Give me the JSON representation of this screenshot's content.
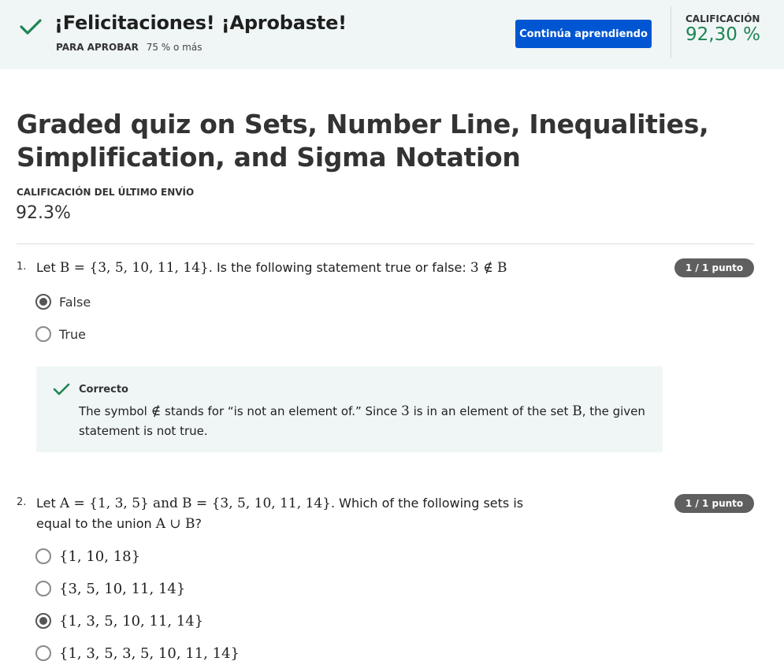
{
  "banner": {
    "title": "¡Felicitaciones! ¡Aprobaste!",
    "pass_label": "PARA APROBAR",
    "pass_value": "75 % o más",
    "continue_button": "Continúa aprendiendo",
    "grade_label": "CALIFICACIÓN",
    "grade_value": "92,30 %",
    "accent_color": "#1e8453",
    "button_color": "#0056d2"
  },
  "quiz": {
    "title": "Graded quiz on Sets, Number Line, Inequalities, Simplification, and Sigma Notation",
    "last_submission_label": "CALIFICACIÓN DEL ÚLTIMO ENVÍO",
    "last_submission_value": "92.3%"
  },
  "questions": [
    {
      "number": "1.",
      "text_parts": [
        "Let",
        "B = {3, 5, 10, 11, 14}",
        ". Is the following statement true or false:",
        "3 ∉ B"
      ],
      "points": "1 / 1 punto",
      "options": [
        {
          "label": "False",
          "selected": true
        },
        {
          "label": "True",
          "selected": false
        }
      ],
      "feedback": {
        "status": "Correcto",
        "parts": [
          "The symbol",
          "∉",
          "stands for “is not an element of.” Since",
          "3",
          "is in an element of the set",
          "B",
          ", the given statement is not true."
        ]
      }
    },
    {
      "number": "2.",
      "text_parts": [
        "Let",
        "A = {1, 3, 5}",
        "and",
        "B = {3, 5, 10, 11, 14}",
        ". Which of the following sets is equal to the union",
        "A ∪ B",
        "?"
      ],
      "points": "1 / 1 punto",
      "options": [
        {
          "label": "{1, 10, 18}",
          "selected": false
        },
        {
          "label": "{3, 5, 10, 11, 14}",
          "selected": false
        },
        {
          "label": "{1, 3, 5, 10, 11, 14}",
          "selected": true
        },
        {
          "label": "{1, 3, 5, 3, 5, 10, 11, 14}",
          "selected": false
        }
      ]
    }
  ]
}
